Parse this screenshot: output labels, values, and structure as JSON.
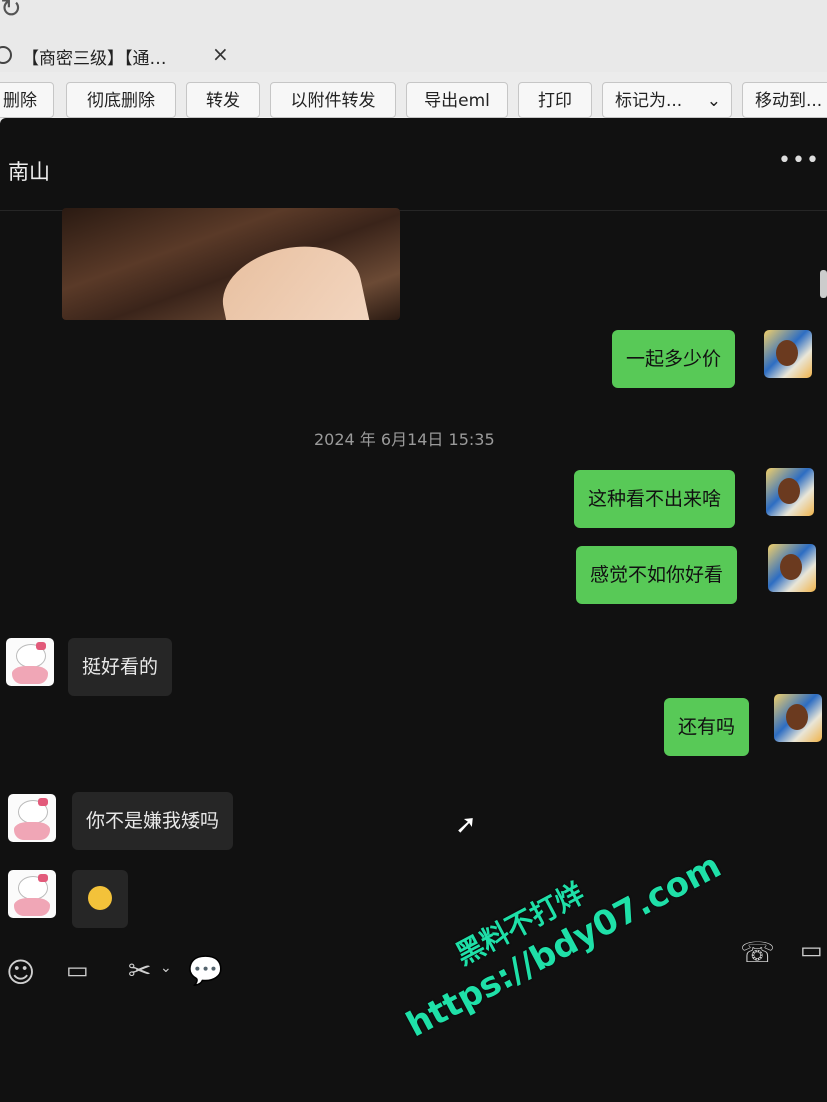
{
  "browser": {
    "reload_icon": "↻",
    "tab_title": "【商密三级】【通…",
    "tab_close": "×"
  },
  "toolbar": {
    "buttons": [
      {
        "label": "删除"
      },
      {
        "label": "彻底删除"
      },
      {
        "label": "转发"
      },
      {
        "label": "以附件转发"
      },
      {
        "label": "导出eml"
      },
      {
        "label": "打印"
      },
      {
        "label": "标记为..."
      },
      {
        "label": "移动到..."
      }
    ]
  },
  "chat": {
    "title": "南山",
    "more": "•••",
    "timestamp": "2024 年 6月14日 15:35",
    "messages": [
      {
        "text": "一起多少价",
        "side": "out"
      },
      {
        "text": "这种看不出来啥",
        "side": "out"
      },
      {
        "text": "感觉不如你好看",
        "side": "out"
      },
      {
        "text": "挺好看的",
        "side": "in"
      },
      {
        "text": "还有吗",
        "side": "out"
      },
      {
        "text": "你不是嫌我矮吗",
        "side": "in"
      }
    ]
  },
  "watermark": {
    "line1": "黑料不打烊",
    "line2": "https://bdy07.com"
  },
  "icons": {
    "emoji": "emoji-icon",
    "folder": "folder-icon",
    "scissors": "scissors-icon",
    "chat": "chat-bubble-icon",
    "phone": "phone-icon",
    "video": "video-icon"
  }
}
